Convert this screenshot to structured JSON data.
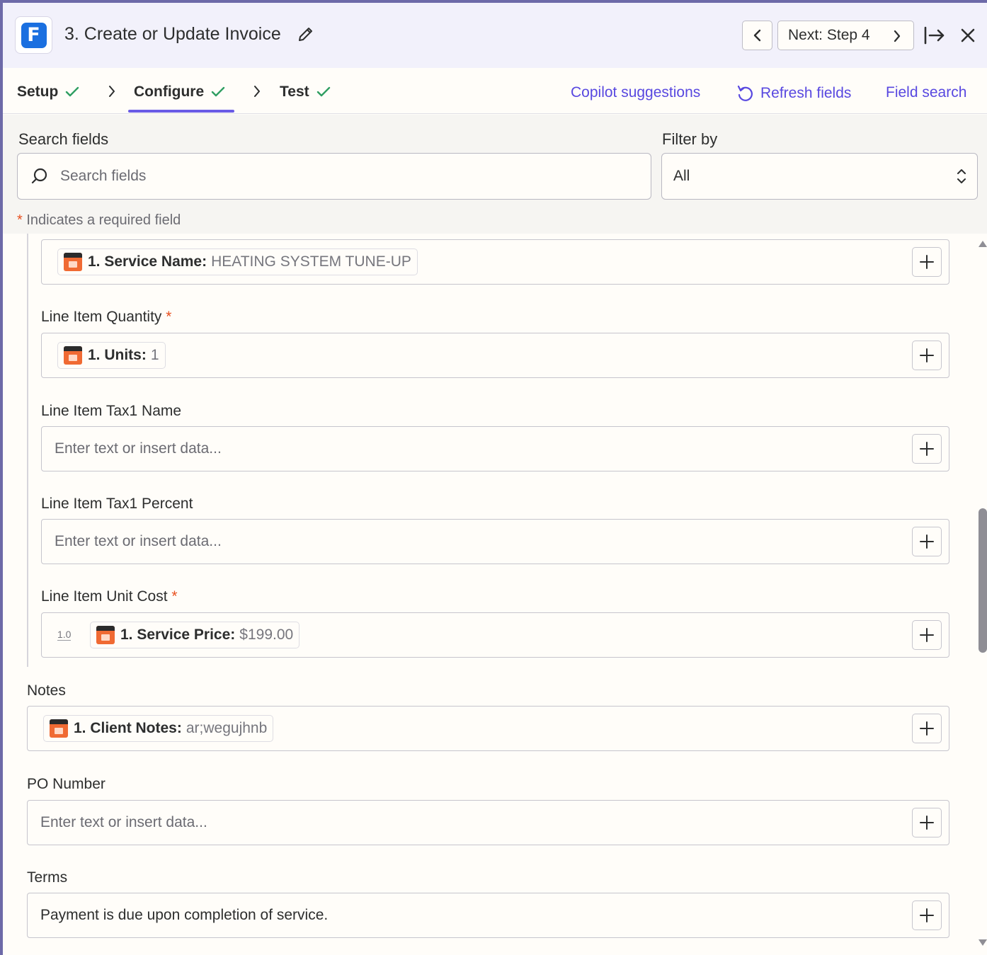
{
  "header": {
    "app_icon": "freshbooks-f-logo",
    "app_letter": "F",
    "title": "3. Create or Update Invoice",
    "next_label": "Next: Step 4"
  },
  "tabs": [
    {
      "label": "Setup",
      "complete": true
    },
    {
      "label": "Configure",
      "complete": true,
      "active": true
    },
    {
      "label": "Test",
      "complete": true
    }
  ],
  "toolbar": {
    "copilot_label": "Copilot suggestions",
    "refresh_label": "Refresh fields",
    "field_search_label": "Field search"
  },
  "search": {
    "label": "Search fields",
    "placeholder": "Search fields",
    "filter_label": "Filter by",
    "filter_value": "All",
    "required_note_star": "*",
    "required_note": "Indicates a required field"
  },
  "fields": {
    "service_name": {
      "pill_label": "1. Service Name:",
      "pill_value": "HEATING SYSTEM TUNE-UP"
    },
    "quantity": {
      "label": "Line Item Quantity",
      "required": "*",
      "pill_label": "1. Units:",
      "pill_value": "1"
    },
    "tax1_name": {
      "label": "Line Item Tax1 Name",
      "placeholder": "Enter text or insert data..."
    },
    "tax1_percent": {
      "label": "Line Item Tax1 Percent",
      "placeholder": "Enter text or insert data..."
    },
    "unit_cost": {
      "label": "Line Item Unit Cost",
      "required": "*",
      "type_badge": "1.0",
      "pill_label": "1. Service Price:",
      "pill_value": "$199.00"
    },
    "notes": {
      "label": "Notes",
      "pill_label": "1. Client Notes:",
      "pill_value": "ar;wegujhnb"
    },
    "po_number": {
      "label": "PO Number",
      "placeholder": "Enter text or insert data..."
    },
    "terms": {
      "label": "Terms",
      "value": "Payment is due upon completion of service."
    }
  },
  "colors": {
    "accent": "#695be6",
    "link": "#5848e0",
    "check": "#2f9e62",
    "required": "#e8501f",
    "source_app": "#f06a33"
  }
}
